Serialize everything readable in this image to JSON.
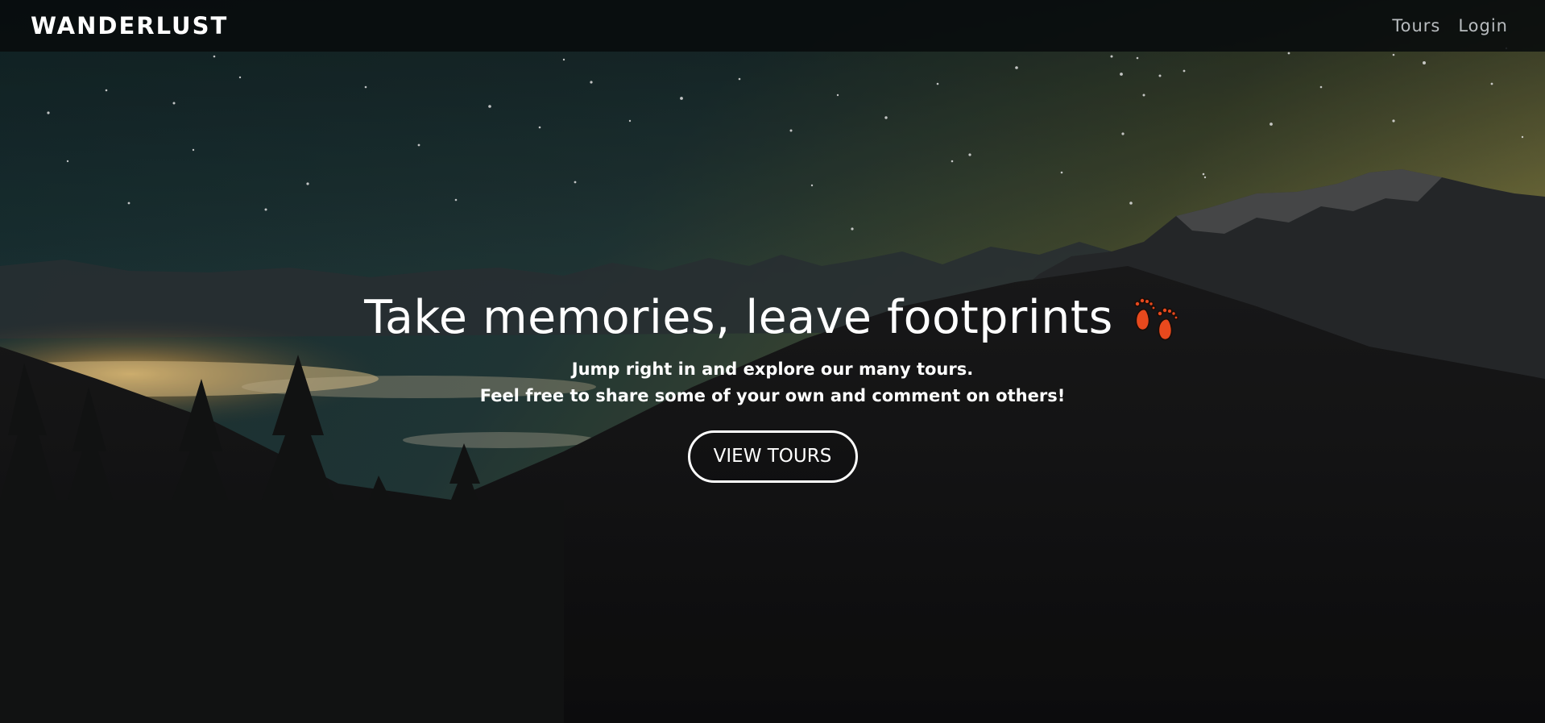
{
  "navbar": {
    "brand": "WANDERLUST",
    "links": [
      {
        "label": "Tours"
      },
      {
        "label": "Login"
      }
    ]
  },
  "hero": {
    "headline": "Take memories, leave footprints",
    "headline_icon": "footprints-icon",
    "subtitle_lines": [
      "Jump right in and explore our many tours.",
      "Feel free to share some of your own and comment on others!"
    ],
    "cta_label": "VIEW TOURS"
  },
  "colors": {
    "navbar_bg": "#080b0c",
    "text": "#ffffff",
    "nav_link": "#b8bcbf",
    "footprints_accent": "#e8491d"
  }
}
